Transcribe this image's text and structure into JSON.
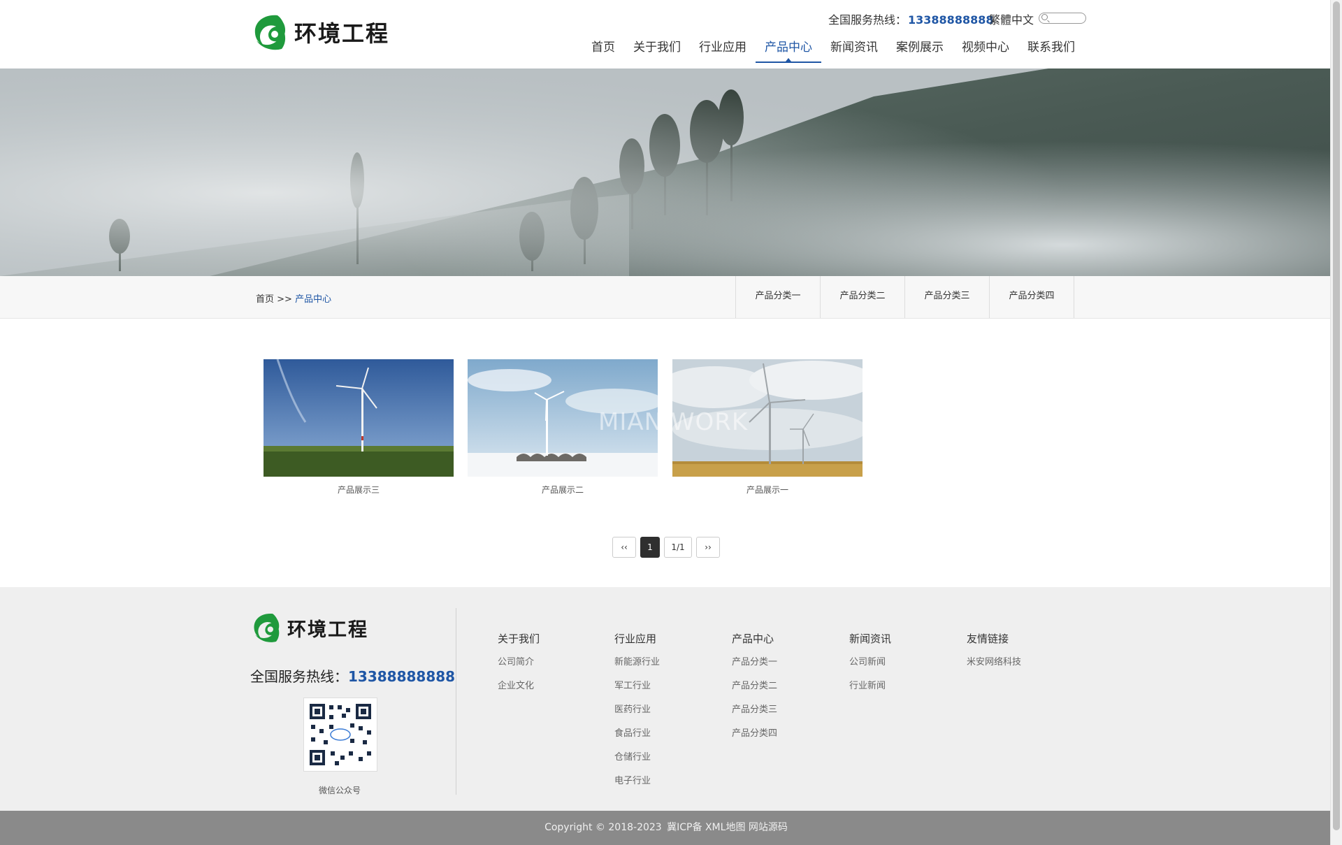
{
  "header": {
    "logo_text": "环境工程",
    "hotline_label": "全国服务热线：",
    "hotline_number": "13388888888",
    "lang_label": "繁體中文",
    "nav": [
      {
        "label": "首页"
      },
      {
        "label": "关于我们"
      },
      {
        "label": "行业应用"
      },
      {
        "label": "产品中心"
      },
      {
        "label": "新闻资讯"
      },
      {
        "label": "案例展示"
      },
      {
        "label": "视频中心"
      },
      {
        "label": "联系我们"
      }
    ],
    "active_nav": "产品中心"
  },
  "breadcrumb": {
    "home": "首页",
    "sep": ">>",
    "current": "产品中心"
  },
  "category_tabs": [
    "产品分类一",
    "产品分类二",
    "产品分类三",
    "产品分类四"
  ],
  "products": [
    {
      "caption": "产品展示三",
      "image": "wind-turbine-over-grass"
    },
    {
      "caption": "产品展示二",
      "image": "wind-turbine-over-snow"
    },
    {
      "caption": "产品展示一",
      "image": "wind-turbines-over-wheat-field"
    }
  ],
  "watermark": "MIAN.WORK",
  "pagination": {
    "prev": "‹‹",
    "current": "1",
    "total": "1/1",
    "next": "››"
  },
  "footer": {
    "logo_text": "环境工程",
    "hotline_label": "全国服务热线：",
    "hotline_number": "13388888888",
    "qr_caption": "微信公众号",
    "columns": [
      {
        "title": "关于我们",
        "links": [
          "公司简介",
          "企业文化"
        ]
      },
      {
        "title": "行业应用",
        "links": [
          "新能源行业",
          "军工行业",
          "医药行业",
          "食品行业",
          "仓储行业",
          "电子行业"
        ]
      },
      {
        "title": "产品中心",
        "links": [
          "产品分类一",
          "产品分类二",
          "产品分类三",
          "产品分类四"
        ]
      },
      {
        "title": "新闻资讯",
        "links": [
          "公司新闻",
          "行业新闻"
        ]
      },
      {
        "title": "友情链接",
        "links": [
          "米安网络科技"
        ]
      }
    ]
  },
  "bottom": {
    "copyright": "Copyright © 2018-2023",
    "icp": "冀ICP备",
    "xml": "XML地图",
    "source": "网站源码"
  },
  "colors": {
    "accent": "#1f56a5",
    "logo_green": "#1f9a3c",
    "footer_bg": "#efefef",
    "bottom_bg": "#8a8a8a"
  }
}
